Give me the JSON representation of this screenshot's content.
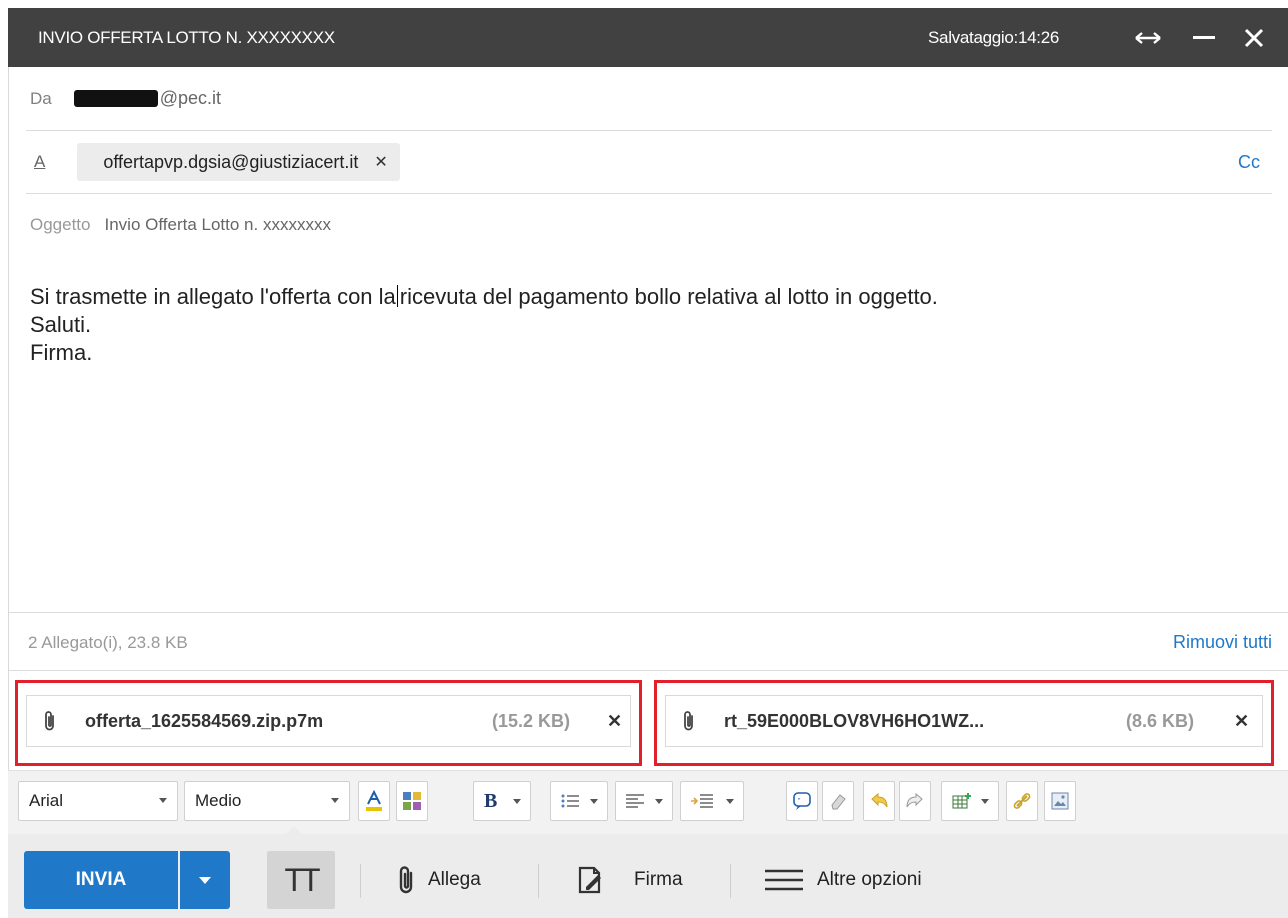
{
  "window": {
    "title": "INVIO OFFERTA LOTTO N. XXXXXXXX",
    "save_status": "Salvataggio:14:26"
  },
  "header": {
    "from_label": "Da",
    "from_domain": "@pec.it",
    "to_label": "A",
    "to_recipient": "offertapvp.dgsia@giustiziacert.it",
    "cc_label": "Cc",
    "subject_label": "Oggetto",
    "subject_value": "Invio Offerta Lotto n. xxxxxxxx"
  },
  "body": {
    "line1_before_caret": "Si trasmette in allegato l'offerta con la",
    "line1_after_caret": "ricevuta del pagamento bollo relativa al lotto in oggetto.",
    "line2": "Saluti.",
    "line3": "Firma."
  },
  "attachments": {
    "summary": "2 Allegato(i), 23.8 KB",
    "remove_all": "Rimuovi tutti",
    "items": [
      {
        "name": "offerta_1625584569.zip.p7m",
        "size": "(15.2 KB)"
      },
      {
        "name": "rt_59E000BLOV8VH6HO1WZ...",
        "size": "(8.6 KB)"
      }
    ]
  },
  "toolbar": {
    "font": "Arial",
    "size": "Medio",
    "bold_glyph": "B",
    "icons": [
      "font-color-icon",
      "highlight-icon",
      "bold-icon",
      "bullet-list-icon",
      "align-icon",
      "indent-icon",
      "quote-icon",
      "eraser-icon",
      "undo-icon",
      "redo-icon",
      "table-icon",
      "link-icon",
      "image-icon"
    ]
  },
  "actions": {
    "send": "INVIA",
    "text_format": "TT",
    "attach": "Allega",
    "signature": "Firma",
    "more": "Altre opzioni"
  },
  "colors": {
    "titlebar": "#414141",
    "accent": "#1f78c8",
    "highlight_box": "#e0202a"
  }
}
